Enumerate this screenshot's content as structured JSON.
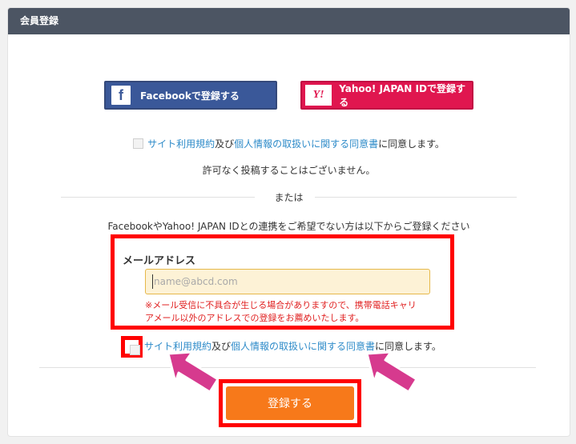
{
  "header": {
    "title": "会員登録"
  },
  "sns": {
    "facebook": {
      "icon_text": "f",
      "label": "Facebookで登録する"
    },
    "yahoo": {
      "icon_text": "Y!",
      "label": "Yahoo! JAPAN IDで登録する"
    }
  },
  "agreement_top": {
    "terms_link": "サイト利用規約",
    "and_text": "及び",
    "privacy_link": "個人情報の取扱いに関する同意書",
    "suffix": "に同意します。"
  },
  "posting_note": "許可なく投稿することはございません。",
  "or_label": "または",
  "alt_instruction": "FacebookやYahoo! JAPAN IDとの連携をご希望でない方は以下からご登録ください",
  "email": {
    "label": "メールアドレス",
    "placeholder": "name@abcd.com",
    "value": "",
    "warning_line1": "※メール受信に不具合が生じる場合がありますので、携帯電話キャリ",
    "warning_line2": "アメール以外のアドレスでの登録をお薦めいたします。"
  },
  "agreement_bottom": {
    "terms_link": "サイト利用規約",
    "and_text": "及び",
    "privacy_link": "個人情報の取扱いに関する同意書",
    "suffix": "に同意します。"
  },
  "submit_label": "登録する",
  "colors": {
    "header_bg": "#4c5563",
    "facebook": "#3a5899",
    "yahoo": "#e0164f",
    "link": "#2e8bc9",
    "highlight_box": "#ff0000",
    "submit": "#f7791a",
    "warning_text": "#e02020",
    "arrow": "#d63a8e"
  }
}
